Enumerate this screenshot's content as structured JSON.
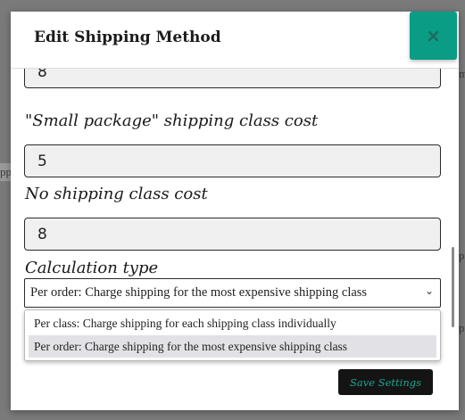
{
  "modal": {
    "title": "Edit Shipping Method",
    "close_label": "×"
  },
  "fields": {
    "top_value": "8",
    "small_package_label": "\"Small package\" shipping class cost",
    "small_package_value": "5",
    "no_class_label": "No shipping class cost",
    "no_class_value": "8",
    "calc_label": "Calculation type",
    "calc_selected": "Per order: Charge shipping for the most expensive shipping class",
    "calc_caret": "⌄",
    "calc_options": [
      "Per class: Charge shipping for each shipping class individually",
      "Per order: Charge shipping for the most expensive shipping class"
    ]
  },
  "actions": {
    "save_label": "Save Settings"
  },
  "background": {
    "fragments": [
      "m",
      "pp",
      "pp",
      "pp"
    ]
  }
}
